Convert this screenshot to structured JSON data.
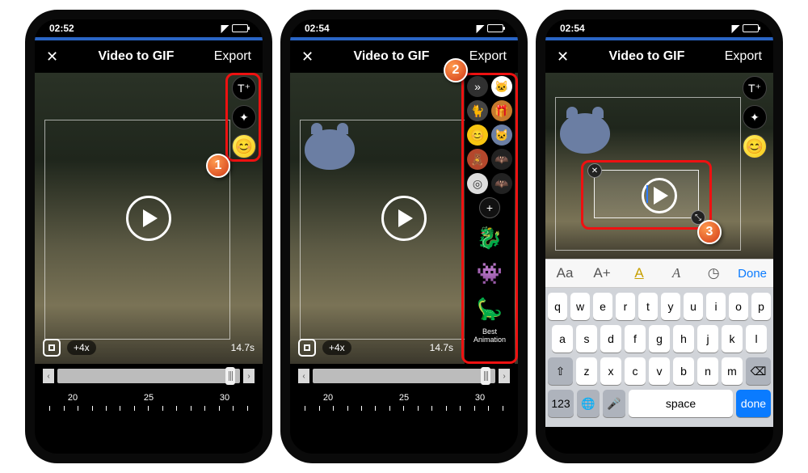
{
  "screen1": {
    "status_time": "02:52",
    "title": "Video to GIF",
    "close": "✕",
    "export": "Export",
    "tools": {
      "text": "T⁺",
      "sticker": "✦"
    },
    "speed": "+4x",
    "duration": "14.7s",
    "ruler": [
      "20",
      "25",
      "30"
    ],
    "callout": "1"
  },
  "screen2": {
    "status_time": "02:54",
    "title": "Video to GIF",
    "close": "✕",
    "export": "Export",
    "panel_chevron": "»",
    "panel_plus": "+",
    "panel_label": "Best Animation",
    "speed": "+4x",
    "duration": "14.7s",
    "ruler": [
      "20",
      "25",
      "30"
    ],
    "callout": "2"
  },
  "screen3": {
    "status_time": "02:54",
    "title": "Video to GIF",
    "close": "✕",
    "export": "Export",
    "tools": {
      "text": "T⁺",
      "sticker": "✦"
    },
    "texttool": {
      "aa": "Aa",
      "aplus": "A+",
      "aunder": "A",
      "italic": "A",
      "history": "◷",
      "done": "Done"
    },
    "keys": {
      "r1": [
        "q",
        "w",
        "e",
        "r",
        "t",
        "y",
        "u",
        "i",
        "o",
        "p"
      ],
      "r2": [
        "a",
        "s",
        "d",
        "f",
        "g",
        "h",
        "j",
        "k",
        "l"
      ],
      "r3_shift": "⇧",
      "r3": [
        "z",
        "x",
        "c",
        "v",
        "b",
        "n",
        "m"
      ],
      "r3_back": "⌫",
      "r4_123": "123",
      "r4_globe": "🌐",
      "r4_mic": "🎤",
      "r4_space": "space",
      "r4_done": "done"
    },
    "callout": "3"
  }
}
